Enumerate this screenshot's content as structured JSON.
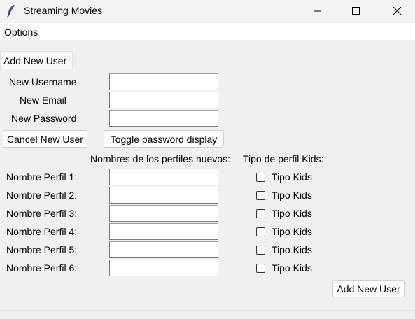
{
  "window": {
    "title": "Streaming Movies",
    "icon": "feather-icon",
    "controls": [
      "minimize-icon",
      "maximize-icon",
      "close-icon"
    ]
  },
  "menu": {
    "options_label": "Options"
  },
  "tab": {
    "label": "Add New User"
  },
  "form": {
    "username_label": "New Username",
    "email_label": "New Email",
    "password_label": "New Password",
    "username_value": "",
    "email_value": "",
    "password_value": ""
  },
  "buttons": {
    "cancel_label": "Cancel New User",
    "toggle_label": "Toggle password display",
    "add_label": "Add New User"
  },
  "profiles": {
    "names_header": "Nombres de los perfiles nuevos:",
    "kids_header": "Tipo de perfil Kids:",
    "rows": [
      {
        "label": "Nombre Perfil 1:",
        "value": "",
        "kids_label": "Tipo Kids",
        "kids_checked": false
      },
      {
        "label": "Nombre Perfil 2:",
        "value": "",
        "kids_label": "Tipo Kids",
        "kids_checked": false
      },
      {
        "label": "Nombre Perfil 3:",
        "value": "",
        "kids_label": "Tipo Kids",
        "kids_checked": false
      },
      {
        "label": "Nombre Perfil 4:",
        "value": "",
        "kids_label": "Tipo Kids",
        "kids_checked": false
      },
      {
        "label": "Nombre Perfil 5:",
        "value": "",
        "kids_label": "Tipo Kids",
        "kids_checked": false
      },
      {
        "label": "Nombre Perfil 6:",
        "value": "",
        "kids_label": "Tipo Kids",
        "kids_checked": false
      }
    ]
  }
}
